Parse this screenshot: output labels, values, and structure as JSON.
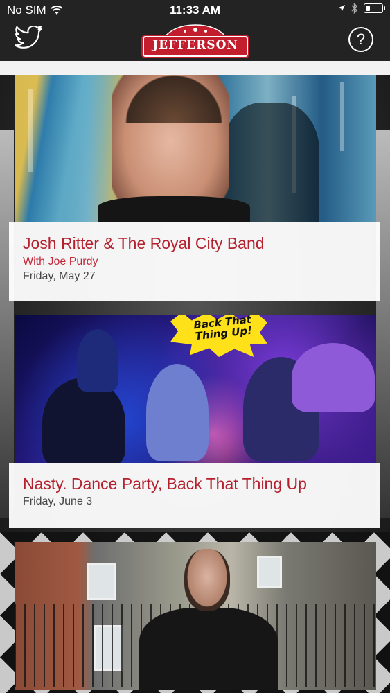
{
  "status_bar": {
    "carrier": "No SIM",
    "time": "11:33 AM",
    "wifi_icon": "wifi-icon",
    "location_icon": "location-arrow-icon",
    "bluetooth_icon": "bluetooth-icon",
    "battery_icon": "battery-icon"
  },
  "navbar": {
    "logo_text": "JEFFERSON",
    "twitter_icon": "twitter-bird-icon",
    "help_label": "?",
    "colors": {
      "bar": "#232323",
      "brand_red": "#c31e2d"
    }
  },
  "events": [
    {
      "title": "Josh Ritter & The Royal City Band",
      "subtitle": "With Joe Purdy",
      "date": "Friday, May 27"
    },
    {
      "title": "Nasty. Dance Party, Back That Thing Up",
      "date": "Friday, June 3",
      "image_text": "Back That Thing Up!"
    },
    {
      "title": "",
      "date": ""
    }
  ],
  "colors": {
    "title": "#b5202e",
    "date": "#444444"
  }
}
